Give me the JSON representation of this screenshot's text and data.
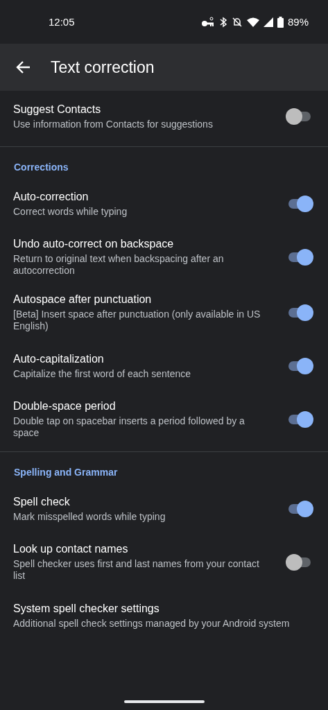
{
  "status_bar": {
    "time": "12:05",
    "battery": "89%"
  },
  "app_bar": {
    "title": "Text correction"
  },
  "sections": [
    {
      "items": [
        {
          "kind": "toggle",
          "title": "Suggest Contacts",
          "summary": "Use information from Contacts for suggestions",
          "on": false
        }
      ]
    },
    {
      "header": "Corrections",
      "items": [
        {
          "kind": "toggle",
          "title": "Auto-correction",
          "summary": "Correct words while typing",
          "on": true
        },
        {
          "kind": "toggle",
          "title": "Undo auto-correct on backspace",
          "summary": "Return to original text when backspacing after an autocorrection",
          "on": true
        },
        {
          "kind": "toggle",
          "title": "Autospace after punctuation",
          "summary": "[Beta] Insert space after punctuation (only available in US English)",
          "on": true
        },
        {
          "kind": "toggle",
          "title": "Auto-capitalization",
          "summary": "Capitalize the first word of each sentence",
          "on": true
        },
        {
          "kind": "toggle",
          "title": "Double-space period",
          "summary": "Double tap on spacebar inserts a period followed by a space",
          "on": true
        }
      ]
    },
    {
      "header": "Spelling and Grammar",
      "items": [
        {
          "kind": "toggle",
          "title": "Spell check",
          "summary": "Mark misspelled words while typing",
          "on": true
        },
        {
          "kind": "toggle",
          "title": "Look up contact names",
          "summary": "Spell checker uses first and last names from your contact list",
          "on": false
        },
        {
          "kind": "link",
          "title": "System spell checker settings",
          "summary": "Additional spell check settings managed by your Android system"
        }
      ]
    }
  ]
}
